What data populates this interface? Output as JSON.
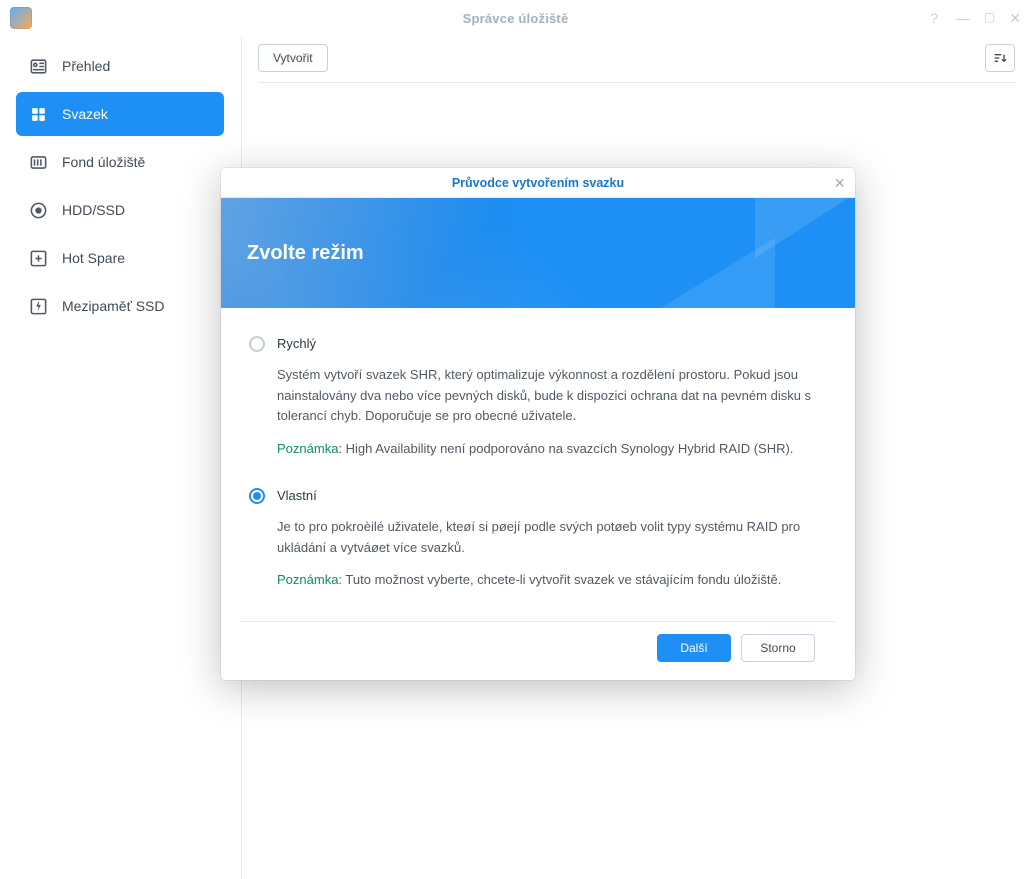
{
  "window": {
    "title": "Správce úložiště"
  },
  "sidebar": {
    "items": [
      {
        "label": "Přehled"
      },
      {
        "label": "Svazek"
      },
      {
        "label": "Fond úložiště"
      },
      {
        "label": "HDD/SSD"
      },
      {
        "label": "Hot Spare"
      },
      {
        "label": "Mezipaměť SSD"
      }
    ]
  },
  "toolbar": {
    "create_label": "Vytvořit"
  },
  "wizard": {
    "title": "Průvodce vytvořením svazku",
    "banner_title": "Zvolte režim",
    "note_key": "Poznámka",
    "options": [
      {
        "label": "Rychlý",
        "desc": "Systém vytvoří svazek SHR, který optimalizuje výkonnost a rozdělení prostoru. Pokud jsou nainstalovány dva nebo více pevných disků, bude k dispozici ochrana dat na pevném disku s tolerancí chyb. Doporučuje se pro obecné uživatele.",
        "note": "High Availability není podporováno na svazcích Synology Hybrid RAID (SHR)."
      },
      {
        "label": "Vlastní",
        "desc": "Je to pro pokroèilé uživatele, kteøí si pøejí podle svých potøeb volit typy systému RAID pro ukládání a vytváøet více svazků.",
        "note": "Tuto možnost vyberte, chcete-li vytvořit svazek ve stávajícím fondu úložiště."
      }
    ],
    "next_label": "Další",
    "cancel_label": "Storno"
  }
}
